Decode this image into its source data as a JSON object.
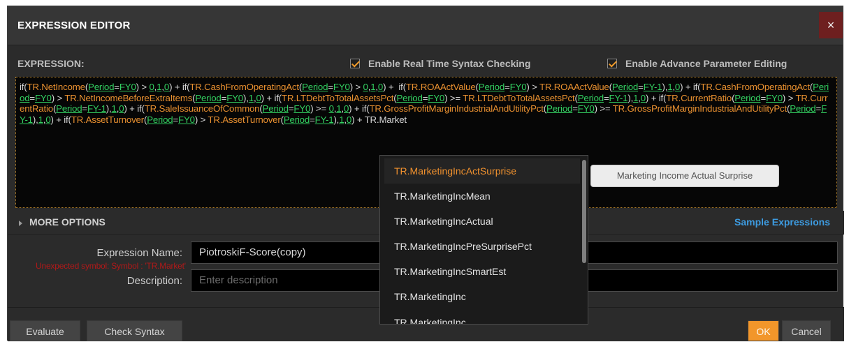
{
  "window": {
    "title": "EXPRESSION EDITOR",
    "close_label": "×"
  },
  "expression": {
    "label": "EXPRESSION:",
    "options": [
      {
        "label": "Enable Real Time Syntax Checking",
        "checked": true
      },
      {
        "label": "Enable Advance Parameter Editing",
        "checked": true
      }
    ],
    "error": "Unexpected symbol: Symbol : 'TR.Market'"
  },
  "more_options": {
    "label": "MORE OPTIONS",
    "sample_link": "Sample Expressions"
  },
  "fields": {
    "name": {
      "label": "Expression Name:",
      "value": "PiotroskiF-Score(copy)"
    },
    "description": {
      "label": "Description:",
      "placeholder": "Enter description"
    }
  },
  "buttons": {
    "evaluate": "Evaluate",
    "check_syntax": "Check Syntax",
    "ok": "OK",
    "cancel": "Cancel"
  },
  "dropdown": {
    "items": [
      "TR.MarketingIncActSurprise",
      "TR.MarketingIncMean",
      "TR.MarketingIncActual",
      "TR.MarketingIncPreSurprisePct",
      "TR.MarketingIncSmartEst",
      "TR.MarketingInc",
      "TR.MarketingInc..."
    ],
    "selected_index": 0,
    "tooltip": "Marketing Income Actual Surprise"
  },
  "colors": {
    "accent": "#f2962a",
    "link": "#3d9be0",
    "param": "#33d061",
    "error": "#b01919"
  }
}
